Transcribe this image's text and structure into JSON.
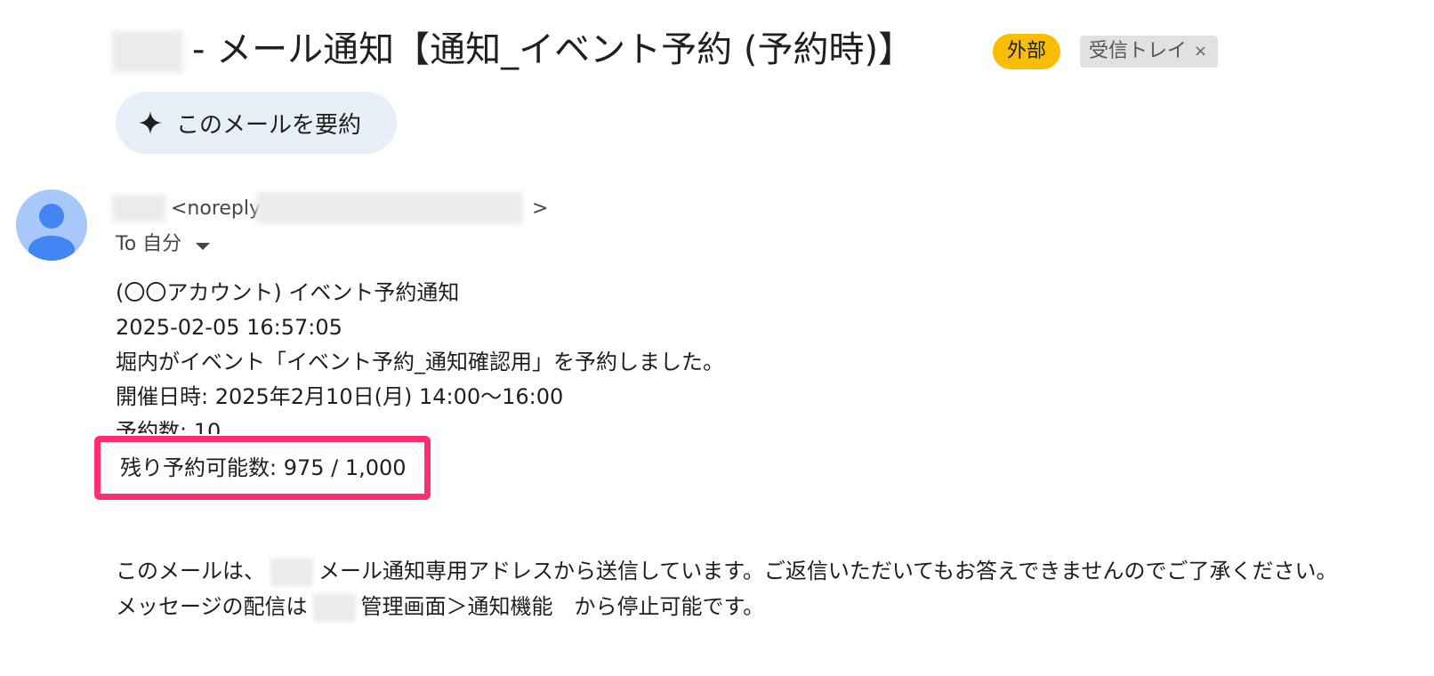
{
  "subject": {
    "title": "- メール通知【通知_イベント予約 (予約時)】",
    "badge_external": "外部",
    "badge_inbox": "受信トレイ",
    "badge_inbox_close": "×"
  },
  "summarize": {
    "label": "このメールを要約",
    "icon": "sparkle-icon"
  },
  "sender": {
    "email_prefix": "<noreply",
    "email_suffix": ">",
    "to_label": "To 自分"
  },
  "body": {
    "lines": [
      "(〇〇アカウント) イベント予約通知",
      "2025-02-05 16:57:05",
      "堀内がイベント「イベント予約_通知確認用」を予約しました。",
      "開催日時: 2025年2月10日(月) 14:00〜16:00"
    ],
    "partial_line": "予約数: 10",
    "highlight_line": "残り予約可能数: 975 / 1,000"
  },
  "footer": {
    "line1_pre": "このメールは、",
    "line1_post": "メール通知専用アドレスから送信しています。ご返信いただいてもお答えできませんのでご了承ください。",
    "line2_pre": "メッセージの配信は",
    "line2_post": "管理画面＞通知機能　から停止可能です。"
  },
  "colors": {
    "highlight": "#ff2e6e",
    "badge_external": "#fbbc04",
    "avatar_bg": "#a8c7fa",
    "avatar_fg": "#4285f4"
  }
}
